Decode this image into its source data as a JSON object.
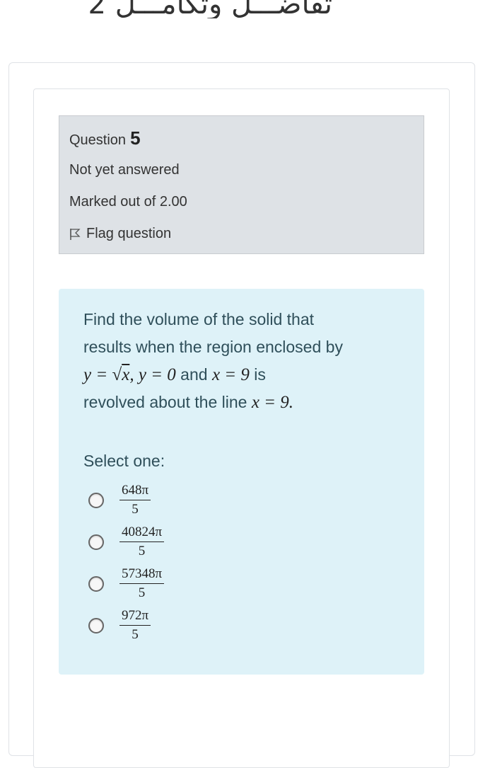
{
  "header": {
    "title": "تفاضـــل وتكامـــل 2"
  },
  "question": {
    "label": "Question",
    "number": "5",
    "state": "Not yet answered",
    "grade": "Marked out of 2.00",
    "flag_label": "Flag question"
  },
  "formulation": {
    "text_line1": "Find the volume of the solid that",
    "text_line2": "results when the region enclosed by",
    "math_y1": "y = ",
    "math_x": "x",
    "math_y2": ", y = 0",
    "and_word": " and ",
    "math_x9": "x = 9",
    "is_word": " is",
    "text_line4": "revolved about the line ",
    "math_line": "x = 9.",
    "prompt": "Select one:",
    "options": [
      {
        "numerator": "648π",
        "denominator": "5"
      },
      {
        "numerator": "40824π",
        "denominator": "5"
      },
      {
        "numerator": "57348π",
        "denominator": "5"
      },
      {
        "numerator": "972π",
        "denominator": "5"
      }
    ]
  }
}
